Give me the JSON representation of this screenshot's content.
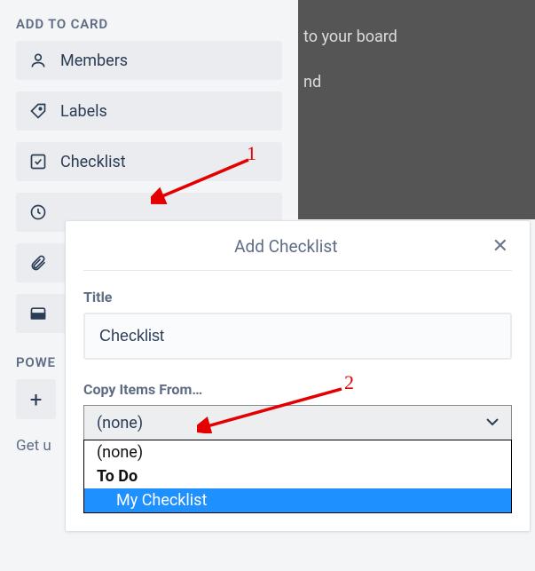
{
  "darkBg": {
    "line1": "to your board",
    "line2": "nd"
  },
  "sidebar": {
    "sectionLabel": "ADD TO CARD",
    "items": [
      {
        "label": "Members"
      },
      {
        "label": "Labels"
      },
      {
        "label": "Checklist"
      },
      {
        "label": ""
      },
      {
        "label": ""
      },
      {
        "label": ""
      }
    ],
    "powerLabel": "POWE",
    "footerText": "Get u"
  },
  "popup": {
    "title": "Add Checklist",
    "titleLabel": "Title",
    "titleValue": "Checklist",
    "copyLabel": "Copy Items From…",
    "selectedOption": "(none)",
    "options": [
      "(none)",
      "To Do",
      "My Checklist"
    ]
  },
  "annotations": {
    "num1": "1",
    "num2": "2"
  }
}
